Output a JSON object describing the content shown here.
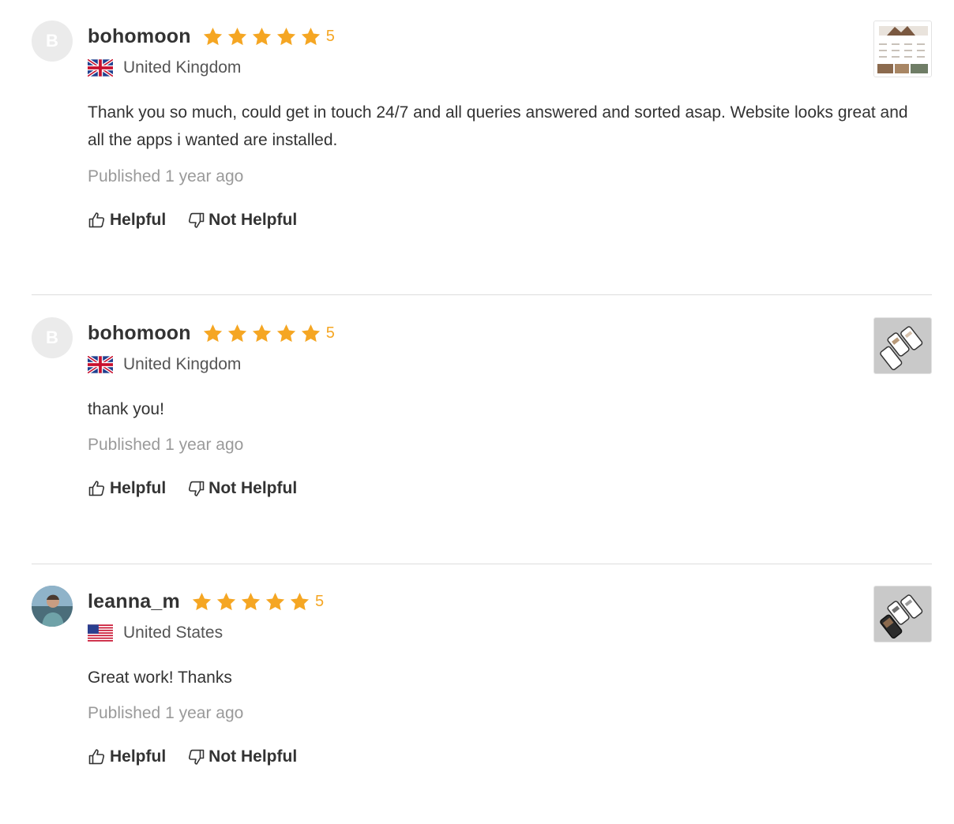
{
  "accent_color": "#f5a623",
  "reviews": [
    {
      "author": "bohomoon",
      "avatar_initial": "B",
      "rating": "5",
      "stars": 5,
      "country": "United Kingdom",
      "flag": "uk-flag",
      "text": "Thank you so much, could get in touch 24/7 and all queries answered and sorted asap. Website looks great and all the apps i wanted are installed.",
      "published": "Published 1 year ago",
      "helpful_label": "Helpful",
      "not_helpful_label": "Not Helpful"
    },
    {
      "author": "bohomoon",
      "avatar_initial": "B",
      "rating": "5",
      "stars": 5,
      "country": "United Kingdom",
      "flag": "uk-flag",
      "text": "thank you!",
      "published": "Published 1 year ago",
      "helpful_label": "Helpful",
      "not_helpful_label": "Not Helpful"
    },
    {
      "author": "leanna_m",
      "avatar_initial": "",
      "rating": "5",
      "stars": 5,
      "country": "United States",
      "flag": "us-flag",
      "text": "Great work! Thanks",
      "published": "Published 1 year ago",
      "helpful_label": "Helpful",
      "not_helpful_label": "Not Helpful"
    }
  ]
}
